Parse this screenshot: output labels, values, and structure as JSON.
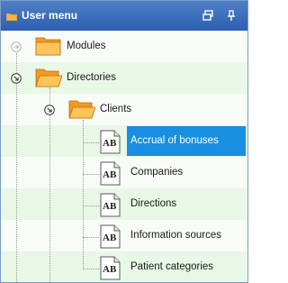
{
  "panel": {
    "title": "User menu"
  },
  "tree": {
    "modules": "Modules",
    "directories": "Directories",
    "clients": "Clients",
    "items": [
      "Accrual of bonuses",
      "Companies",
      "Directions",
      "Information sources",
      "Patient categories"
    ],
    "selected": "Accrual of bonuses"
  },
  "icons": {
    "title": "folder-icon",
    "restore": "restore-icon",
    "pin": "pin-icon",
    "modules_expander": "expand-arrow-icon",
    "directories_expander": "collapse-arrow-icon",
    "clients_expander": "collapse-arrow-icon",
    "leaf": "document-ab-icon",
    "folder": "folder-icon"
  },
  "colors": {
    "titlebar": "#3a6bbd",
    "selection": "#1a8ee0",
    "row_green": "#e8f7e6",
    "row_white": "#f7fcf6"
  }
}
